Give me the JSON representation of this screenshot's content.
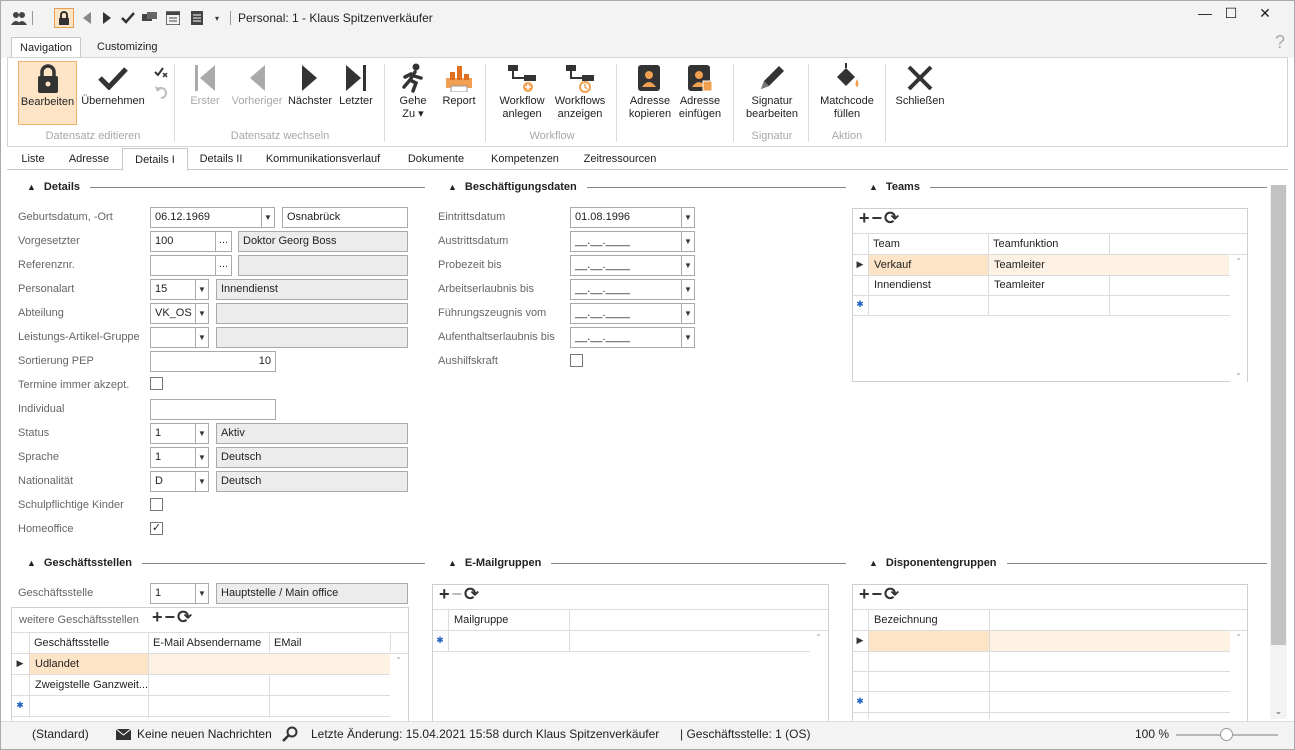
{
  "window": {
    "title": "Personal: 1 - Klaus Spitzenverkäufer",
    "minimize": "—",
    "maximize": "☐",
    "close": "✕"
  },
  "ribbon_tabs": [
    "Navigation",
    "Customizing"
  ],
  "help": "?",
  "ribbon": {
    "bearbeiten": "Bearbeiten",
    "uebernehmen": "Übernehmen",
    "erster": "Erster",
    "vorheriger": "Vorheriger",
    "naechster": "Nächster",
    "letzter": "Letzter",
    "gehe_zu": "Gehe",
    "gehe_zu2": "Zu ▾",
    "report": "Report",
    "wf_anlegen": "Workflow",
    "wf_anlegen2": "anlegen",
    "wf_anzeigen": "Workflows",
    "wf_anzeigen2": "anzeigen",
    "adr_kopieren": "Adresse",
    "adr_kopieren2": "kopieren",
    "adr_einfuegen": "Adresse",
    "adr_einfuegen2": "einfügen",
    "signatur": "Signatur",
    "signatur2": "bearbeiten",
    "matchcode": "Matchcode",
    "matchcode2": "füllen",
    "schliessen": "Schließen",
    "groups": {
      "datensatz_edit": "Datensatz editieren",
      "datensatz_wechseln": "Datensatz wechseln",
      "workflow": "Workflow",
      "signatur": "Signatur",
      "aktion": "Aktion"
    }
  },
  "doc_tabs": [
    "Liste",
    "Adresse",
    "Details I",
    "Details II",
    "Kommunikationsverlauf",
    "Dokumente",
    "Kompetenzen",
    "Zeitressourcen"
  ],
  "details": {
    "title": "Details",
    "geburt_lbl": "Geburtsdatum, -Ort",
    "geburt": "06.12.1969",
    "ort": "Osnabrück",
    "vorg_lbl": "Vorgesetzter",
    "vorg_nr": "100",
    "vorg_name": "Doktor Georg Boss",
    "ref_lbl": "Referenznr.",
    "pa_lbl": "Personalart",
    "pa": "15",
    "pa_name": "Innendienst",
    "abt_lbl": "Abteilung",
    "abt": "VK_OS",
    "lag_lbl": "Leistungs-Artikel-Gruppe",
    "pep_lbl": "Sortierung PEP",
    "pep": "10",
    "term_lbl": "Termine immer akzept.",
    "ind_lbl": "Individual",
    "status_lbl": "Status",
    "status": "1",
    "status_name": "Aktiv",
    "sprache_lbl": "Sprache",
    "sprache": "1",
    "sprache_name": "Deutsch",
    "nat_lbl": "Nationalität",
    "nat": "D",
    "nat_name": "Deutsch",
    "kinder_lbl": "Schulpflichtige Kinder",
    "home_lbl": "Homeoffice",
    "dots": "...",
    "check": "✓"
  },
  "besch": {
    "title": "Beschäftigungsdaten",
    "eintritt_lbl": "Eintrittsdatum",
    "eintritt": "01.08.1996",
    "austritt_lbl": "Austrittsdatum",
    "probe_lbl": "Probezeit bis",
    "arbeit_lbl": "Arbeitserlaubnis bis",
    "fuehr_lbl": "Führungszeugnis vom",
    "aufent_lbl": "Aufenthaltserlaubnis bis",
    "aushilfe_lbl": "Aushilfskraft",
    "empty_date": "__.__.____"
  },
  "teams": {
    "title": "Teams",
    "cols": [
      "Team",
      "Teamfunktion"
    ],
    "rows": [
      [
        "Verkauf",
        "Teamleiter"
      ],
      [
        "Innendienst",
        "Teamleiter"
      ]
    ]
  },
  "gst": {
    "title": "Geschäftsstellen",
    "lbl": "Geschäftsstelle",
    "val": "1",
    "name": "Hauptstelle / Main office",
    "weitere": "weitere Geschäftsstellen",
    "cols": [
      "Geschäftsstelle",
      "E-Mail Absendername",
      "EMail"
    ],
    "rows": [
      "Udlandet",
      "Zweigstelle Ganzweit..."
    ]
  },
  "email": {
    "title": "E-Mailgruppen",
    "cols": [
      "Mailgruppe"
    ]
  },
  "dispo": {
    "title": "Disponentengruppen",
    "cols": [
      "Bezeichnung"
    ]
  },
  "status": {
    "standard": "(Standard)",
    "messages": "Keine neuen Nachrichten",
    "last_change": "Letzte Änderung: 15.04.2021 15:58 durch Klaus Spitzenverkäufer",
    "gst": "| Geschäftsstelle:  1 (OS)",
    "zoom": "100 %",
    "zoom_level": 0.5
  }
}
